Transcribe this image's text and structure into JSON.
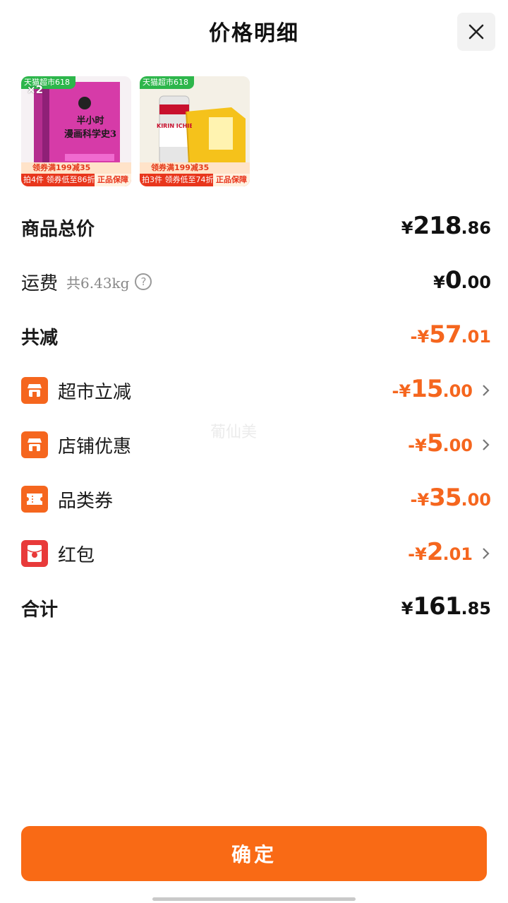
{
  "header": {
    "title": "价格明细"
  },
  "products": [
    {
      "tag": "天猫超市618",
      "qty": "×2",
      "cover_title": "半小时\n漫画科学史3",
      "coupon": "领券满199减35",
      "deal": "拍4件 领券低至86折",
      "guarantee": "正品保障"
    },
    {
      "tag": "天猫超市618",
      "qty": "",
      "cover_title": "KIRIN ICHIBAN",
      "coupon": "领券满199减35",
      "deal": "拍3件 领券低至74折",
      "guarantee": "正品保障"
    }
  ],
  "rows": {
    "total_goods": {
      "label": "商品总价",
      "yen": "¥",
      "int": "218",
      "dec": ".86"
    },
    "shipping": {
      "label": "运费",
      "weight": "共6.43kg",
      "help": "?",
      "yen": "¥",
      "int": "0",
      "dec": ".00"
    },
    "total_discount": {
      "label": "共减",
      "prefix": "-¥",
      "int": "57",
      "dec": ".01"
    },
    "supermarket": {
      "label": "超市立减",
      "prefix": "-¥",
      "int": "15",
      "dec": ".00"
    },
    "store": {
      "label": "店铺优惠",
      "prefix": "-¥",
      "int": "5",
      "dec": ".00"
    },
    "category": {
      "label": "品类券",
      "prefix": "-¥",
      "int": "35",
      "dec": ".00"
    },
    "redpacket": {
      "label": "红包",
      "prefix": "-¥",
      "int": "2",
      "dec": ".01"
    },
    "grand_total": {
      "label": "合计",
      "yen": "¥",
      "int": "161",
      "dec": ".85"
    }
  },
  "watermark": "葡仙美",
  "confirm_label": "确定",
  "colors": {
    "accent": "#f96a15",
    "discount": "#f5661e",
    "redpacket": "#e83a3a"
  }
}
